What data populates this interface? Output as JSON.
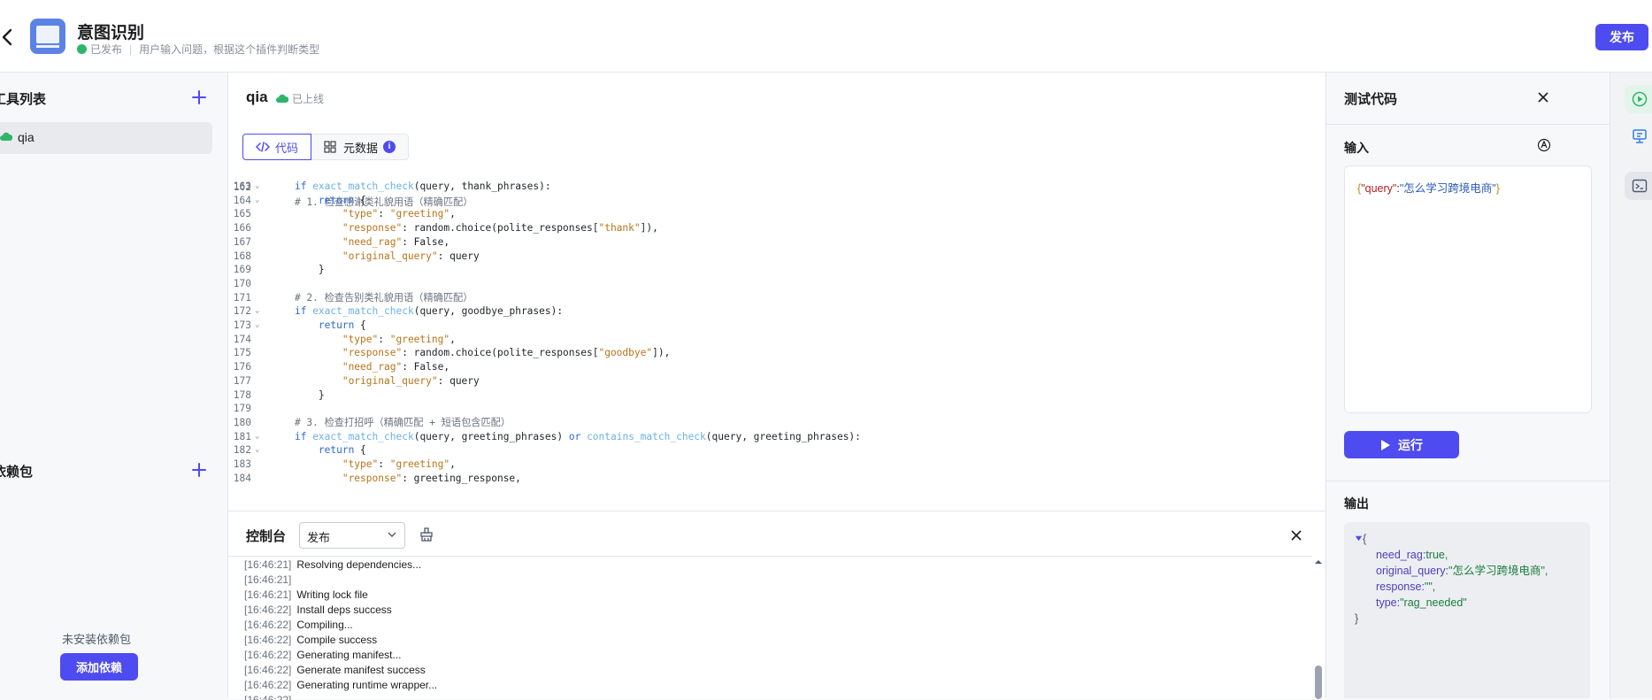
{
  "header": {
    "title": "意图识别",
    "status": "已发布",
    "description": "用户输入问题，根据这个插件判断类型",
    "publish_label": "发布"
  },
  "sidebar": {
    "tools_title": "工具列表",
    "tools": [
      {
        "label": "qia"
      }
    ],
    "deps_title": "依赖包",
    "empty_deps": "未安装依赖包",
    "add_deps_label": "添加依赖"
  },
  "main": {
    "tool_name": "qia",
    "online_status": "已上线",
    "tabs": [
      {
        "label": "代码"
      },
      {
        "label": "元数据"
      }
    ],
    "metadata_badge": "i"
  },
  "code": {
    "top_partial": "    # 1. 检查感谢类礼貌用语（精确匹配）",
    "lines": [
      {
        "n": "163",
        "fold": true,
        "text": "    if exact_match_check(query, thank_phrases):"
      },
      {
        "n": "164",
        "fold": true,
        "text": "        return {"
      },
      {
        "n": "165",
        "fold": false,
        "text": "            \"type\": \"greeting\","
      },
      {
        "n": "166",
        "fold": false,
        "text": "            \"response\": random.choice(polite_responses[\"thank\"]),"
      },
      {
        "n": "167",
        "fold": false,
        "text": "            \"need_rag\": False,"
      },
      {
        "n": "168",
        "fold": false,
        "text": "            \"original_query\": query"
      },
      {
        "n": "169",
        "fold": false,
        "text": "        }"
      },
      {
        "n": "170",
        "fold": false,
        "text": ""
      },
      {
        "n": "171",
        "fold": false,
        "text": "    # 2. 检查告别类礼貌用语（精确匹配）"
      },
      {
        "n": "172",
        "fold": true,
        "text": "    if exact_match_check(query, goodbye_phrases):"
      },
      {
        "n": "173",
        "fold": true,
        "text": "        return {"
      },
      {
        "n": "174",
        "fold": false,
        "text": "            \"type\": \"greeting\","
      },
      {
        "n": "175",
        "fold": false,
        "text": "            \"response\": random.choice(polite_responses[\"goodbye\"]),"
      },
      {
        "n": "176",
        "fold": false,
        "text": "            \"need_rag\": False,"
      },
      {
        "n": "177",
        "fold": false,
        "text": "            \"original_query\": query"
      },
      {
        "n": "178",
        "fold": false,
        "text": "        }"
      },
      {
        "n": "179",
        "fold": false,
        "text": ""
      },
      {
        "n": "180",
        "fold": false,
        "text": "    # 3. 检查打招呼（精确匹配 + 短语包含匹配）"
      },
      {
        "n": "181",
        "fold": true,
        "text": "    if exact_match_check(query, greeting_phrases) or contains_match_check(query, greeting_phrases):"
      },
      {
        "n": "182",
        "fold": true,
        "text": "        return {"
      },
      {
        "n": "183",
        "fold": false,
        "text": "            \"type\": \"greeting\","
      },
      {
        "n": "184",
        "fold": false,
        "text": "            \"response\": greeting_response,"
      }
    ]
  },
  "console": {
    "title": "控制台",
    "selected": "发布",
    "logs": [
      {
        "ts": "[16:46:21]",
        "msg": "Resolving dependencies..."
      },
      {
        "ts": "[16:46:21]",
        "msg": ""
      },
      {
        "ts": "[16:46:21]",
        "msg": "Writing lock file"
      },
      {
        "ts": "[16:46:22]",
        "msg": "Install deps success"
      },
      {
        "ts": "[16:46:22]",
        "msg": "Compiling..."
      },
      {
        "ts": "[16:46:22]",
        "msg": "Compile success"
      },
      {
        "ts": "[16:46:22]",
        "msg": "Generating manifest..."
      },
      {
        "ts": "[16:46:22]",
        "msg": "Generate manifest success"
      },
      {
        "ts": "[16:46:22]",
        "msg": "Generating runtime wrapper..."
      },
      {
        "ts": "[16:46:22]",
        "msg": ""
      }
    ]
  },
  "test": {
    "title": "测试代码",
    "input_label": "输入",
    "input": {
      "key": "\"query\"",
      "value": "\"怎么学习跨境电商\""
    },
    "run_label": "运行",
    "output_label": "输出",
    "output": [
      {
        "key": "need_rag",
        "value": "true,"
      },
      {
        "key": "original_query",
        "value": "\"怎么学习跨境电商\","
      },
      {
        "key": "response",
        "value": "\"\","
      },
      {
        "key": "type",
        "value": "\"rag_needed\""
      }
    ]
  },
  "colors": {
    "accent": "#4e4bf0",
    "success": "#2fb56b"
  }
}
